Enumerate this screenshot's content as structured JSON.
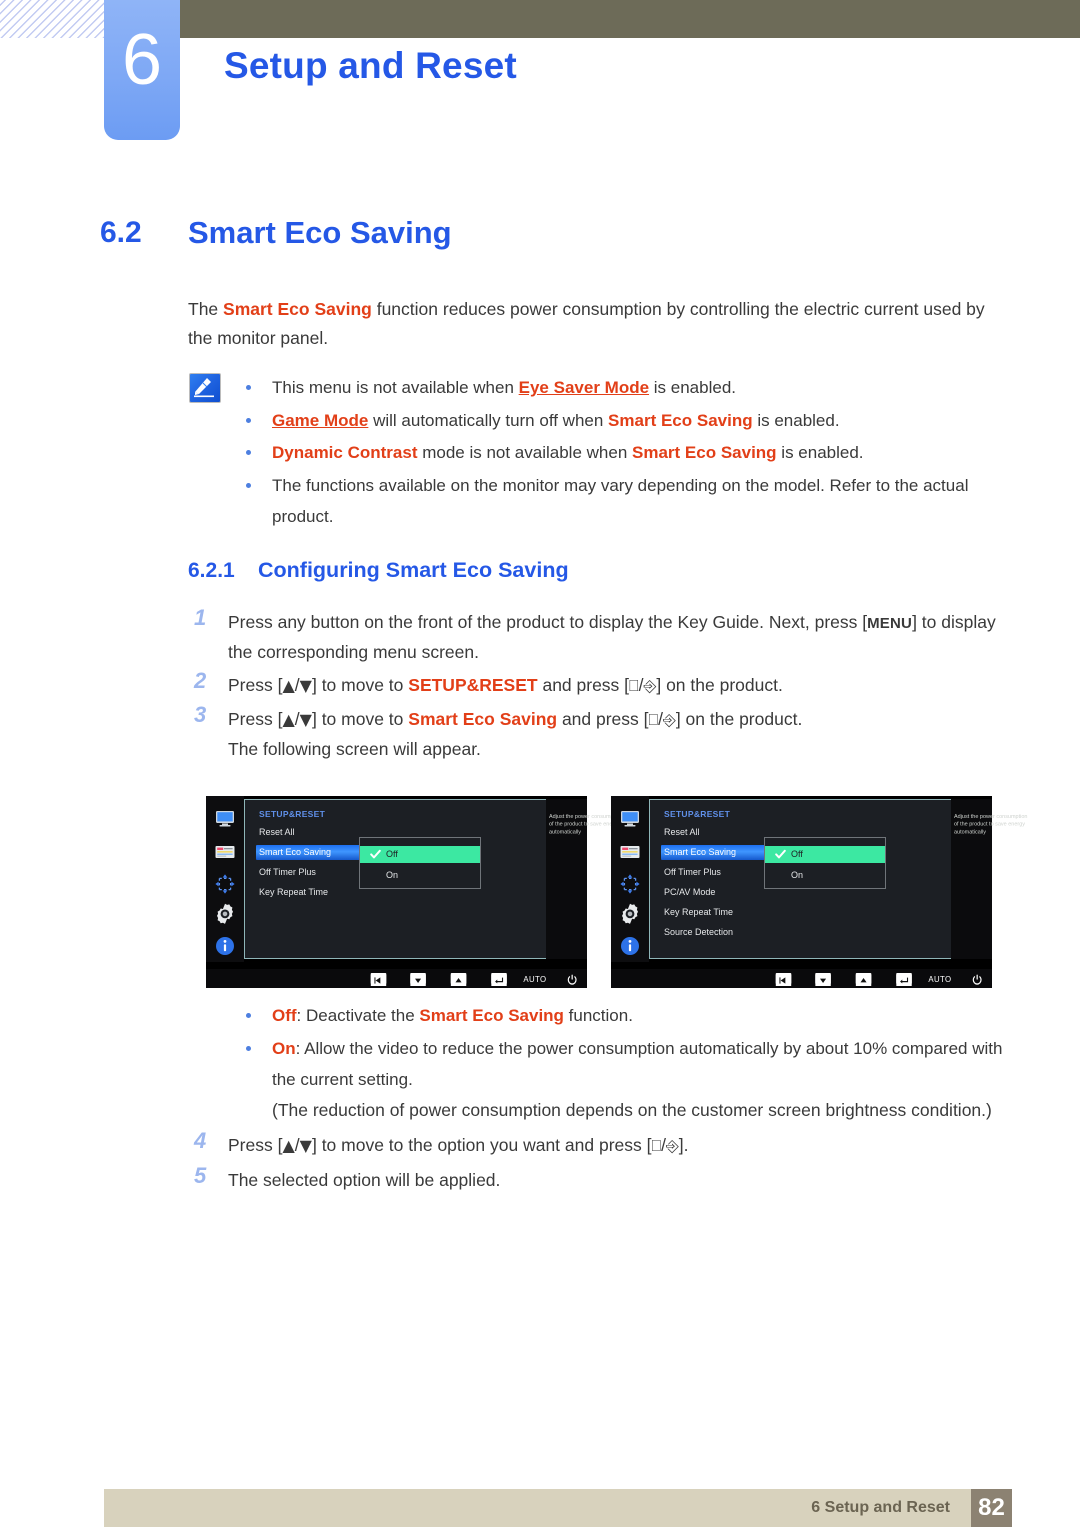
{
  "header": {
    "chapter_number": "6",
    "chapter_title": "Setup and Reset",
    "hatch_icon": "diagonal-hatch-pattern",
    "bar_color": "#6d6b58",
    "accent_color": "#2558e6"
  },
  "section": {
    "number": "6.2",
    "title": "Smart Eco Saving"
  },
  "intro": {
    "text_1": "The ",
    "kw_1": "Smart Eco Saving",
    "text_2": " function reduces power consumption by controlling the electric current used by the monitor panel."
  },
  "note": {
    "icon": "note-pen-icon",
    "bullets": [
      {
        "parts": [
          {
            "t": "This menu is not available when ",
            "s": "plain"
          },
          {
            "t": "Eye Saver Mode",
            "s": "kw-underline"
          },
          {
            "t": " is enabled.",
            "s": "plain"
          }
        ]
      },
      {
        "parts": [
          {
            "t": "Game Mode",
            "s": "kw-underline"
          },
          {
            "t": " will automatically turn off when ",
            "s": "plain"
          },
          {
            "t": "Smart Eco Saving",
            "s": "kw"
          },
          {
            "t": " is enabled.",
            "s": "plain"
          }
        ]
      },
      {
        "parts": [
          {
            "t": "Dynamic Contrast",
            "s": "kw"
          },
          {
            "t": " mode is not available when ",
            "s": "plain"
          },
          {
            "t": "Smart Eco Saving",
            "s": "kw"
          },
          {
            "t": " is enabled.",
            "s": "plain"
          }
        ]
      },
      {
        "parts": [
          {
            "t": "The functions available on the monitor may vary depending on the model. Refer to the actual product.",
            "s": "plain"
          }
        ]
      }
    ]
  },
  "subsection": {
    "number": "6.2.1",
    "title": "Configuring Smart Eco Saving"
  },
  "steps": [
    {
      "number": "1",
      "html": "Press any button on the front of the product to display the Key Guide. Next, press [<b class=\"kbd\">MENU</b>] to display the corresponding menu screen."
    },
    {
      "number": "2",
      "html": "Press [<span class=\"gly\">&#9650;</span>/<span class=\"gly\">&#9660;</span>] to move to <span class=\"kw\">SETUP&amp;RESET</span> and press [<span class=\"gly\">&#9109;</span>/<span class=\"gly\">&#9094;</span>] on the product."
    },
    {
      "number": "3",
      "html": "Press [<span class=\"gly\">&#9650;</span>/<span class=\"gly\">&#9660;</span>] to move to <span class=\"kw\">Smart Eco Saving</span> and press [<span class=\"gly\">&#9109;</span>/<span class=\"gly\">&#9094;</span>] on the product."
    }
  ],
  "after_step3": "The following screen will appear.",
  "osd": {
    "left": {
      "menu_title": "SETUP&RESET",
      "items": [
        "Reset All",
        "Smart Eco Saving",
        "Off Timer Plus",
        "Key Repeat Time"
      ],
      "selected_item": "Smart Eco Saving",
      "options": [
        "Off",
        "On"
      ],
      "selected_option": "Off",
      "description": "Adjust the power consumption of the product to save energy automatically",
      "rail_icons": [
        "monitor-icon",
        "picture-settings-icon",
        "screen-adjust-icon",
        "gear-icon",
        "info-icon"
      ],
      "buttons": [
        "left-arrow-button",
        "down-arrow-button",
        "up-arrow-button",
        "enter-button"
      ],
      "auto_label": "AUTO",
      "power_icon": "power-icon",
      "highlight_color": "#3ce8a2",
      "selected_color": "#1d6ff0"
    },
    "right": {
      "menu_title": "SETUP&RESET",
      "items": [
        "Reset All",
        "Smart Eco Saving",
        "Off Timer Plus",
        "PC/AV Mode",
        "Key Repeat Time",
        "Source Detection"
      ],
      "selected_item": "Smart Eco Saving",
      "options": [
        "Off",
        "On"
      ],
      "selected_option": "Off",
      "description": "Adjust the power consumption of the product to save energy automatically",
      "rail_icons": [
        "monitor-icon",
        "picture-settings-icon",
        "screen-adjust-icon",
        "gear-icon",
        "info-icon"
      ],
      "buttons": [
        "left-arrow-button",
        "down-arrow-button",
        "up-arrow-button",
        "enter-button"
      ],
      "auto_label": "AUTO",
      "power_icon": "power-icon",
      "highlight_color": "#3ce8a2",
      "selected_color": "#1d6ff0"
    }
  },
  "option_bullets": [
    {
      "parts": [
        {
          "t": "Off",
          "s": "kw"
        },
        {
          "t": ": Deactivate the ",
          "s": "plain"
        },
        {
          "t": "Smart Eco Saving",
          "s": "kw"
        },
        {
          "t": " function.",
          "s": "plain"
        }
      ]
    },
    {
      "parts": [
        {
          "t": "On",
          "s": "kw"
        },
        {
          "t": ": Allow the video to reduce the power consumption automatically by about 10% compared with the current setting.",
          "s": "plain"
        }
      ]
    }
  ],
  "reduction_note": "(The reduction of power consumption depends on the customer screen brightness condition.)",
  "steps_after": [
    {
      "number": "4",
      "html": "Press [<span class=\"gly\">&#9650;</span>/<span class=\"gly\">&#9660;</span>] to move to the option you want and press [<span class=\"gly\">&#9109;</span>/<span class=\"gly\">&#9094;</span>]."
    },
    {
      "number": "5",
      "html": "The selected option will be applied."
    }
  ],
  "footer": {
    "text": "6 Setup and Reset",
    "page": "82",
    "band_color": "#d8d2bd",
    "page_box_color": "#8c8272"
  }
}
